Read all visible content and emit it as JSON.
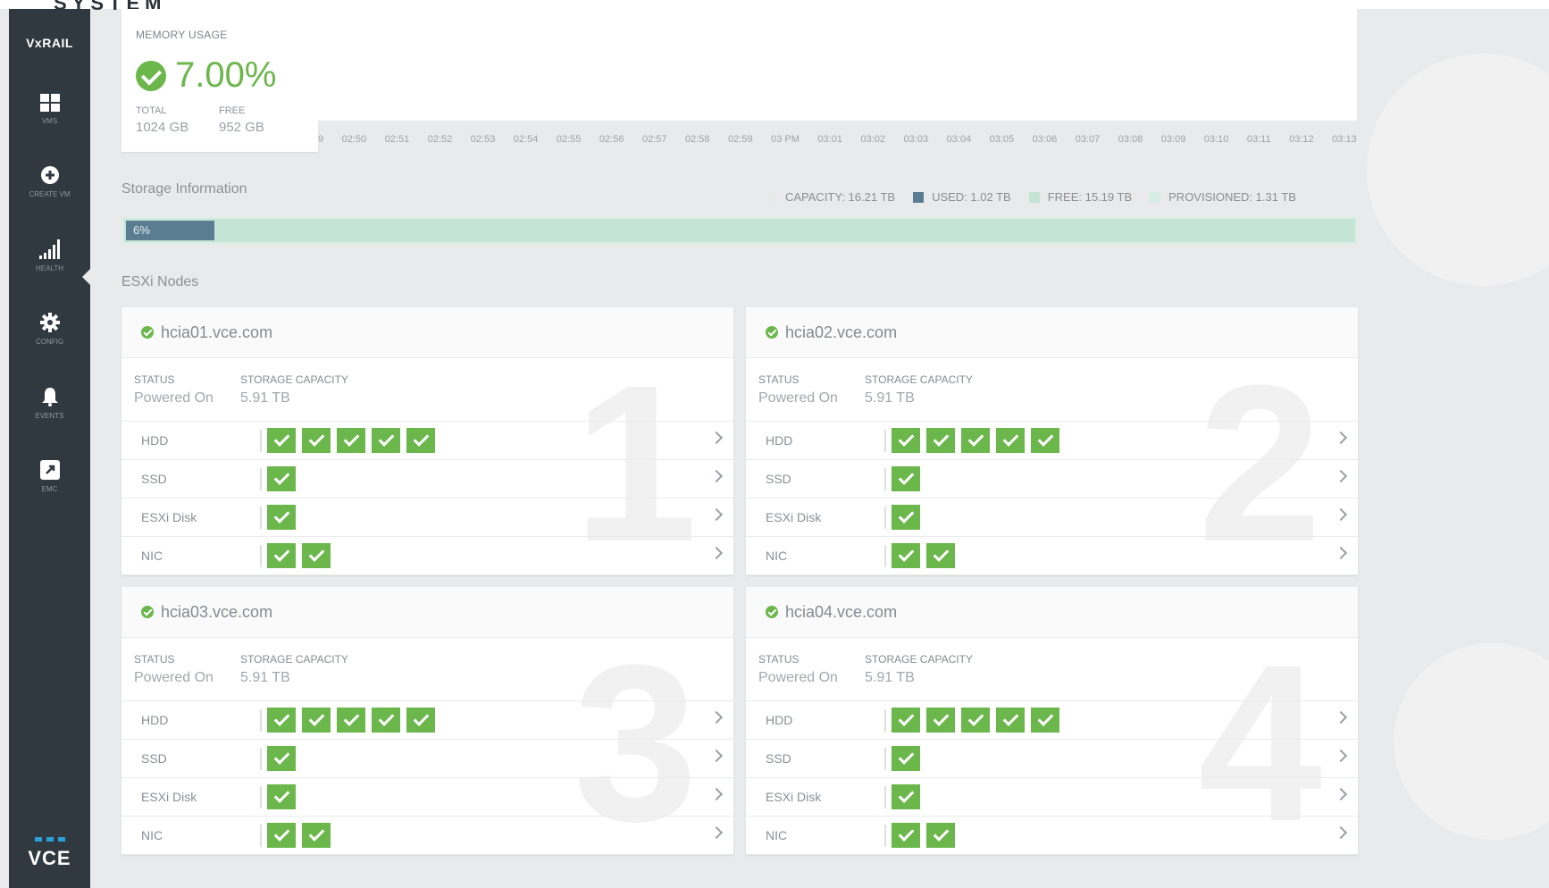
{
  "top_fragment": "SYSTEM",
  "sidebar": {
    "logo": "VxRAIL",
    "items": [
      {
        "label": "VMS",
        "icon": "grid-icon"
      },
      {
        "label": "CREATE VM",
        "icon": "plus-circle-icon"
      },
      {
        "label": "HEALTH",
        "icon": "signal-bars-icon",
        "active": true
      },
      {
        "label": "CONFIG",
        "icon": "gear-icon"
      },
      {
        "label": "EVENTS",
        "icon": "bell-icon"
      },
      {
        "label": "EMC",
        "icon": "external-link-icon"
      }
    ],
    "brand": "VCE"
  },
  "memory": {
    "title": "MEMORY USAGE",
    "value": "7.00%",
    "total_label": "TOTAL",
    "total_value": "1024 GB",
    "free_label": "FREE",
    "free_value": "952 GB"
  },
  "time_axis": [
    "9",
    "02:50",
    "02:51",
    "02:52",
    "02:53",
    "02:54",
    "02:55",
    "02:56",
    "02:57",
    "02:58",
    "02:59",
    "03 PM",
    "03:01",
    "03:02",
    "03:03",
    "03:04",
    "03:05",
    "03:06",
    "03:07",
    "03:08",
    "03:09",
    "03:10",
    "03:11",
    "03:12",
    "03:13"
  ],
  "storage": {
    "title": "Storage Information",
    "used_fraction": 0.06,
    "percent_label": "6%",
    "legend": [
      {
        "text": "CAPACITY: 16.21 TB",
        "color": "#e6ebe9"
      },
      {
        "text": "USED: 1.02 TB",
        "color": "#5a7d92"
      },
      {
        "text": "FREE: 15.19 TB",
        "color": "#c4e4d5"
      },
      {
        "text": "PROVISIONED: 1.31 TB",
        "color": "#d5ede2"
      }
    ]
  },
  "esxi": {
    "title": "ESXi Nodes",
    "status_label": "STATUS",
    "capacity_label": "STORAGE CAPACITY",
    "nodes": [
      {
        "number": "1",
        "name": "hcia01.vce.com",
        "status": "Powered On",
        "capacity": "5.91 TB",
        "rows": [
          {
            "name": "HDD",
            "checks": 5
          },
          {
            "name": "SSD",
            "checks": 1
          },
          {
            "name": "ESXi Disk",
            "checks": 1
          },
          {
            "name": "NIC",
            "checks": 2
          }
        ]
      },
      {
        "number": "2",
        "name": "hcia02.vce.com",
        "status": "Powered On",
        "capacity": "5.91 TB",
        "rows": [
          {
            "name": "HDD",
            "checks": 5
          },
          {
            "name": "SSD",
            "checks": 1
          },
          {
            "name": "ESXi Disk",
            "checks": 1
          },
          {
            "name": "NIC",
            "checks": 2
          }
        ]
      },
      {
        "number": "3",
        "name": "hcia03.vce.com",
        "status": "Powered On",
        "capacity": "5.91 TB",
        "rows": [
          {
            "name": "HDD",
            "checks": 5
          },
          {
            "name": "SSD",
            "checks": 1
          },
          {
            "name": "ESXi Disk",
            "checks": 1
          },
          {
            "name": "NIC",
            "checks": 2
          }
        ]
      },
      {
        "number": "4",
        "name": "hcia04.vce.com",
        "status": "Powered On",
        "capacity": "5.91 TB",
        "rows": [
          {
            "name": "HDD",
            "checks": 5
          },
          {
            "name": "SSD",
            "checks": 1
          },
          {
            "name": "ESXi Disk",
            "checks": 1
          },
          {
            "name": "NIC",
            "checks": 2
          }
        ]
      }
    ]
  }
}
